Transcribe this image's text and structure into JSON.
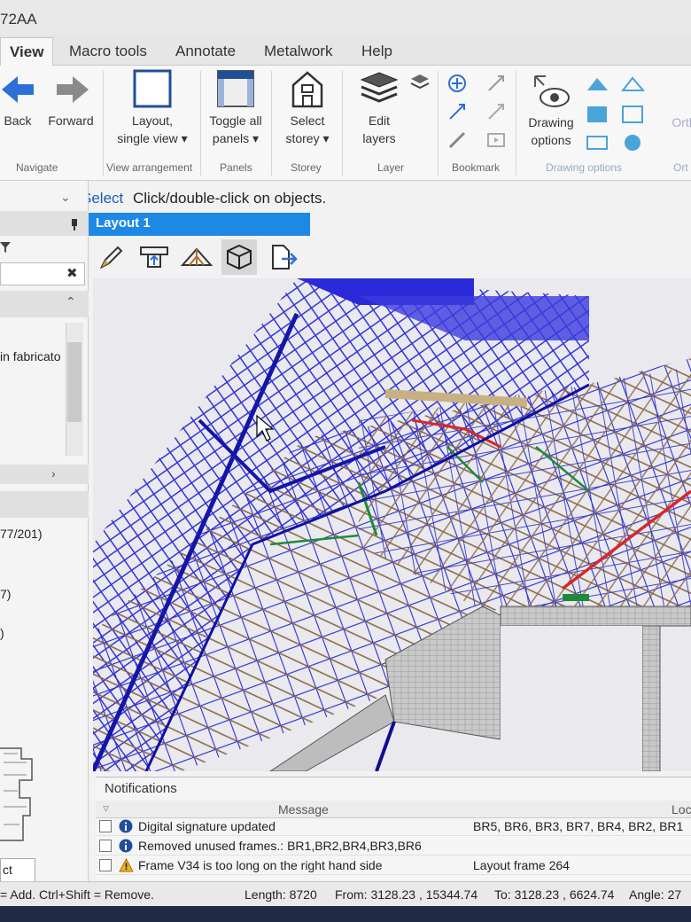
{
  "app": {
    "title": "72AA"
  },
  "tabs": [
    "View",
    "Macro tools",
    "Annotate",
    "Metalwork",
    "Help"
  ],
  "ribbon": {
    "back": "Back",
    "forward": "Forward",
    "layout": [
      "Layout,",
      "single view ▾"
    ],
    "toggle_panels": [
      "Toggle all",
      "panels ▾"
    ],
    "select_storey": [
      "Select",
      "storey ▾"
    ],
    "edit_layers": [
      "Edit",
      "layers"
    ],
    "drawing_options": [
      "Drawing",
      "options"
    ],
    "ortho": "Orth",
    "groups": [
      "Navigate",
      "View arrangement",
      "Panels",
      "Storey",
      "Layer",
      "Bookmark",
      "Drawing options",
      "Ort"
    ]
  },
  "prompt": {
    "keyword": "Select",
    "text": "Click/double-click on objects."
  },
  "left_panel": {
    "fabricator_text": "in fabricato",
    "coord_text": "77/201)",
    "num_text": "7)",
    "paren": ")",
    "tab_fragment": "ct"
  },
  "layout_tab": {
    "label": "Layout 1"
  },
  "tools": [
    "pencil-icon",
    "roof-section-icon",
    "truss-icon",
    "cube-3d-icon",
    "export-icon"
  ],
  "notifications": {
    "title": "Notifications",
    "columns": {
      "message": "Message",
      "location": "Loc"
    },
    "rows": [
      {
        "type": "info",
        "message": "Digital signature updated",
        "location": "BR5, BR6, BR3, BR7, BR4, BR2, BR1"
      },
      {
        "type": "info",
        "message": "Removed unused frames.: BR1,BR2,BR4,BR3,BR6",
        "location": ""
      },
      {
        "type": "warning",
        "message": "Frame V34 is too long on the right hand side",
        "location": "Layout frame 264"
      }
    ]
  },
  "statusbar": {
    "hint": "= Add.  Ctrl+Shift = Remove.",
    "length": "Length: 8720",
    "from": "From: 3128.23 , 15344.74",
    "to": "To: 3128.23 , 6624.74",
    "angle": "Angle: 27"
  },
  "colors": {
    "accent": "#1e88e5",
    "frame_blue": "#2a2ad8",
    "frame_brown": "#8a6a4a",
    "frame_red": "#d62828",
    "frame_green": "#1f8a3a"
  }
}
